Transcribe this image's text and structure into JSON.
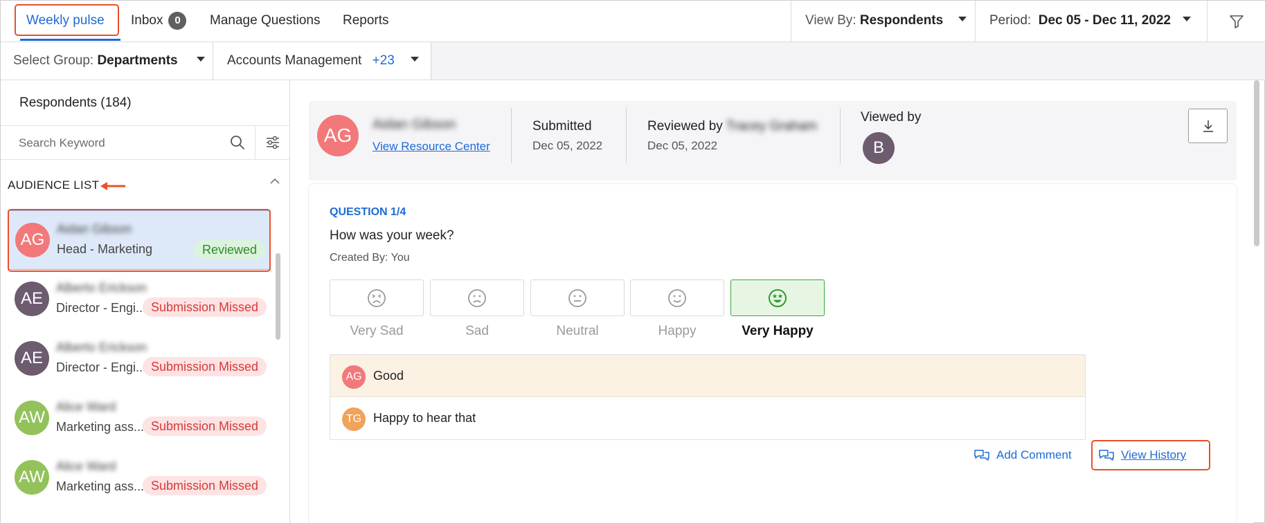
{
  "topbar": {
    "tabs": [
      {
        "label": "Weekly pulse",
        "active": true
      },
      {
        "label": "Inbox",
        "count": "0"
      },
      {
        "label": "Manage Questions"
      },
      {
        "label": "Reports"
      }
    ],
    "view_by": {
      "label": "View By:",
      "value": "Respondents"
    },
    "period": {
      "label": "Period:",
      "value": "Dec 05 - Dec 11, 2022"
    },
    "filter_icon": "funnel-icon"
  },
  "groupbar": {
    "select_label": "Select Group:",
    "select_value": "Departments",
    "group_name": "Accounts Management",
    "group_more": "+23"
  },
  "sidebar": {
    "title": "Respondents (184)",
    "search_placeholder": "Search Keyword",
    "section_label": "AUDIENCE LIST",
    "items": [
      {
        "initials": "AG",
        "name": "Aidan Gibson",
        "role": "Head - Marketing",
        "status": "Reviewed",
        "avatar_color": "#f2787a",
        "selected": true
      },
      {
        "initials": "AE",
        "name": "Alberto Erickson",
        "role": "Director - Engi...",
        "status": "Submission Missed",
        "avatar_color": "#6d5b6e"
      },
      {
        "initials": "AE",
        "name": "Alberto Erickson",
        "role": "Director - Engi...",
        "status": "Submission Missed",
        "avatar_color": "#6d5b6e"
      },
      {
        "initials": "AW",
        "name": "Alice Ward",
        "role": "Marketing ass...",
        "status": "Submission Missed",
        "avatar_color": "#93c25a"
      },
      {
        "initials": "AW",
        "name": "Alice Ward",
        "role": "Marketing ass...",
        "status": "Submission Missed",
        "avatar_color": "#93c25a"
      }
    ]
  },
  "header": {
    "initials": "AG",
    "name": "Aidan Gibson",
    "link": "View Resource Center",
    "submitted_label": "Submitted",
    "submitted_date": "Dec 05, 2022",
    "reviewed_label": "Reviewed by",
    "reviewer": "Tracey Graham",
    "reviewed_date": "Dec 05, 2022",
    "viewed_label": "Viewed by",
    "viewer_initial": "B"
  },
  "question": {
    "number": "QUESTION 1/4",
    "text": "How was your week?",
    "created_by": "Created By: You",
    "moods": [
      {
        "label": "Very Sad",
        "icon": "very-sad-face-icon"
      },
      {
        "label": "Sad",
        "icon": "sad-face-icon"
      },
      {
        "label": "Neutral",
        "icon": "neutral-face-icon"
      },
      {
        "label": "Happy",
        "icon": "happy-face-icon"
      },
      {
        "label": "Very Happy",
        "icon": "very-happy-face-icon",
        "selected": true
      }
    ],
    "comments": [
      {
        "initials": "AG",
        "text": "Good",
        "avatar_color": "#f2787a"
      },
      {
        "initials": "TG",
        "text": "Happy to hear that",
        "avatar_color": "#f0a35a"
      }
    ],
    "add_comment": "Add Comment",
    "view_history": "View History"
  },
  "colors": {
    "accent": "#1e6ad6",
    "highlight": "#e8502a",
    "selected_mood": "#3aa73a"
  }
}
